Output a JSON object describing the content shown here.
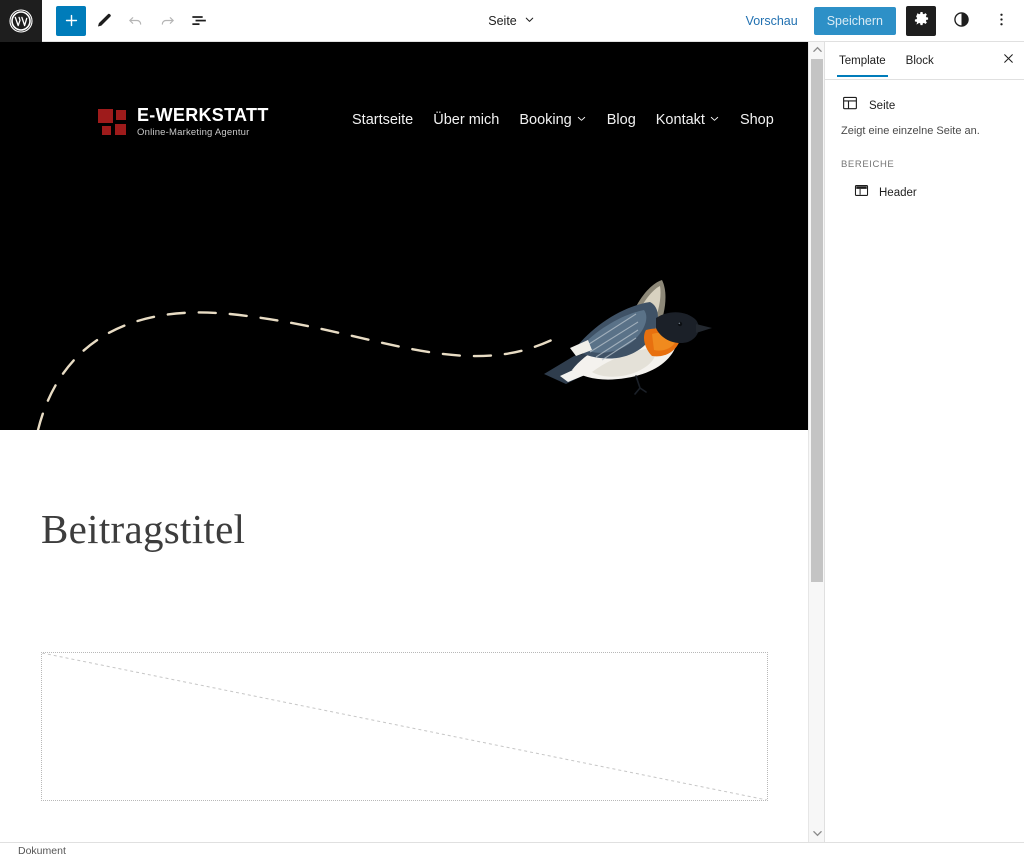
{
  "editor": {
    "logo_icon": "wordpress-logo",
    "toolbar_left": [
      {
        "name": "add-block",
        "icon": "plus-icon",
        "label": "+"
      },
      {
        "name": "edit-tool",
        "icon": "pencil-icon",
        "label": ""
      },
      {
        "name": "undo",
        "icon": "undo-arrow-icon",
        "label": ""
      },
      {
        "name": "redo",
        "icon": "redo-arrow-icon",
        "label": ""
      },
      {
        "name": "document-overview",
        "icon": "details-list-icon",
        "label": ""
      }
    ],
    "document_switcher": {
      "label": "Seite",
      "chevron": "chevron-down-icon"
    },
    "preview_label": "Vorschau",
    "save_label": "Speichern",
    "settings_icon": "gear-icon",
    "contrast_icon": "half-circle-contrast-icon",
    "more_icon": "kebab-menu-icon"
  },
  "sidebar": {
    "tabs": [
      {
        "label": "Template",
        "active": true
      },
      {
        "label": "Block",
        "active": false
      }
    ],
    "close_icon": "close-icon",
    "template": {
      "icon": "template-layout-icon",
      "name": "Seite",
      "description": "Zeigt eine einzelne Seite an."
    },
    "areas_heading": "BEREICHE",
    "areas": [
      {
        "icon": "header-layout-icon",
        "label": "Header"
      }
    ]
  },
  "site": {
    "logo": {
      "icon": "red-squares-logo-mark",
      "title": "E-WERKSTATT",
      "subtitle": "Online-Marketing  Agentur",
      "mark_color": "#9e1b1b"
    },
    "nav": [
      {
        "label": "Startseite",
        "has_submenu": false
      },
      {
        "label": "Über mich",
        "has_submenu": false
      },
      {
        "label": "Booking",
        "has_submenu": true
      },
      {
        "label": "Blog",
        "has_submenu": false
      },
      {
        "label": "Kontakt",
        "has_submenu": true
      },
      {
        "label": "Shop",
        "has_submenu": false
      }
    ],
    "hero": {
      "background_color": "#000000",
      "trail_color": "#e8dcc4",
      "image_name": "flying-bird-image"
    }
  },
  "post": {
    "title": "Beitragstitel",
    "featured_image_placeholder": "broken-image-placeholder"
  },
  "status": {
    "document_label": "Dokument"
  },
  "scrollbar": {
    "up_icon": "scroll-up-arrow-icon",
    "down_icon": "scroll-down-arrow-icon"
  }
}
